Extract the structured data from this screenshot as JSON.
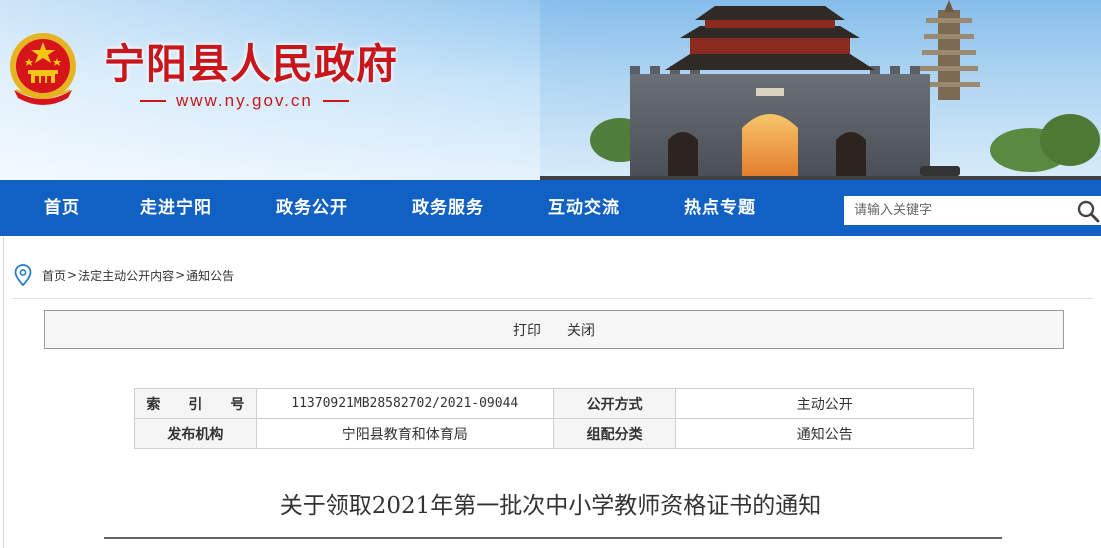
{
  "header": {
    "site_title": "宁阳县人民政府",
    "site_url": "www.ny.gov.cn",
    "colors": {
      "title_red": "#c8161d",
      "nav_blue": "#1160c3"
    }
  },
  "nav": {
    "items": [
      {
        "label": "首页"
      },
      {
        "label": "走进宁阳"
      },
      {
        "label": "政务公开"
      },
      {
        "label": "政务服务"
      },
      {
        "label": "互动交流"
      },
      {
        "label": "热点专题"
      }
    ],
    "search": {
      "placeholder": "请输入关键字",
      "value": "",
      "icon": "search-icon"
    }
  },
  "breadcrumb": {
    "icon": "location-pin-icon",
    "items": [
      {
        "label": "首页"
      },
      {
        "label": "法定主动公开内容"
      },
      {
        "label": "通知公告"
      }
    ],
    "separator": ">"
  },
  "toolbar": {
    "print_label": "打印",
    "close_label": "关闭"
  },
  "meta": {
    "index_label": "索　　引　　号",
    "index_value": "11370921MB28582702/2021-09044",
    "disclosure_label": "公开方式",
    "disclosure_value": "主动公开",
    "publisher_label": "发布机构",
    "publisher_value": "宁阳县教育和体育局",
    "category_label": "组配分类",
    "category_value": "通知公告"
  },
  "article": {
    "title": "关于领取2021年第一批次中小学教师资格证书的通知"
  }
}
